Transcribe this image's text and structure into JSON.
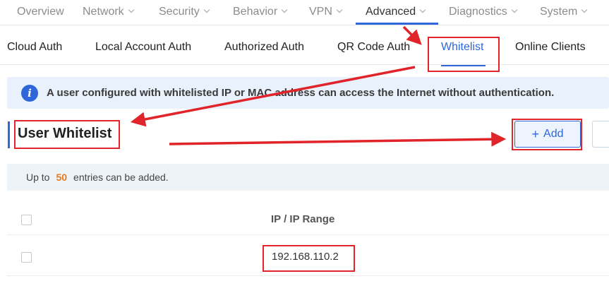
{
  "topnav": {
    "items": [
      {
        "label": "Overview"
      },
      {
        "label": "Network"
      },
      {
        "label": "Security"
      },
      {
        "label": "Behavior"
      },
      {
        "label": "VPN"
      },
      {
        "label": "Advanced"
      },
      {
        "label": "Diagnostics"
      },
      {
        "label": "System"
      }
    ],
    "active": "Advanced"
  },
  "subtabs": {
    "items": [
      {
        "label": "Cloud Auth"
      },
      {
        "label": "Local Account Auth"
      },
      {
        "label": "Authorized Auth"
      },
      {
        "label": "QR Code Auth"
      },
      {
        "label": "Whitelist"
      },
      {
        "label": "Online Clients"
      }
    ],
    "active": "Whitelist"
  },
  "banner": {
    "icon": "info-icon",
    "text": "A user configured with whitelisted IP or MAC address can access the Internet without authentication."
  },
  "section": {
    "title": "User Whitelist",
    "add_label": "Add",
    "add_icon": "plus-icon"
  },
  "note": {
    "prefix": "Up to",
    "count": "50",
    "suffix": "entries can be added."
  },
  "table": {
    "columns": [
      "IP / IP Range"
    ],
    "rows": [
      {
        "ip": "192.168.110.2"
      }
    ]
  },
  "colors": {
    "accent": "#2f66d9",
    "highlight": "#e0242a",
    "count": "#e6791f"
  }
}
